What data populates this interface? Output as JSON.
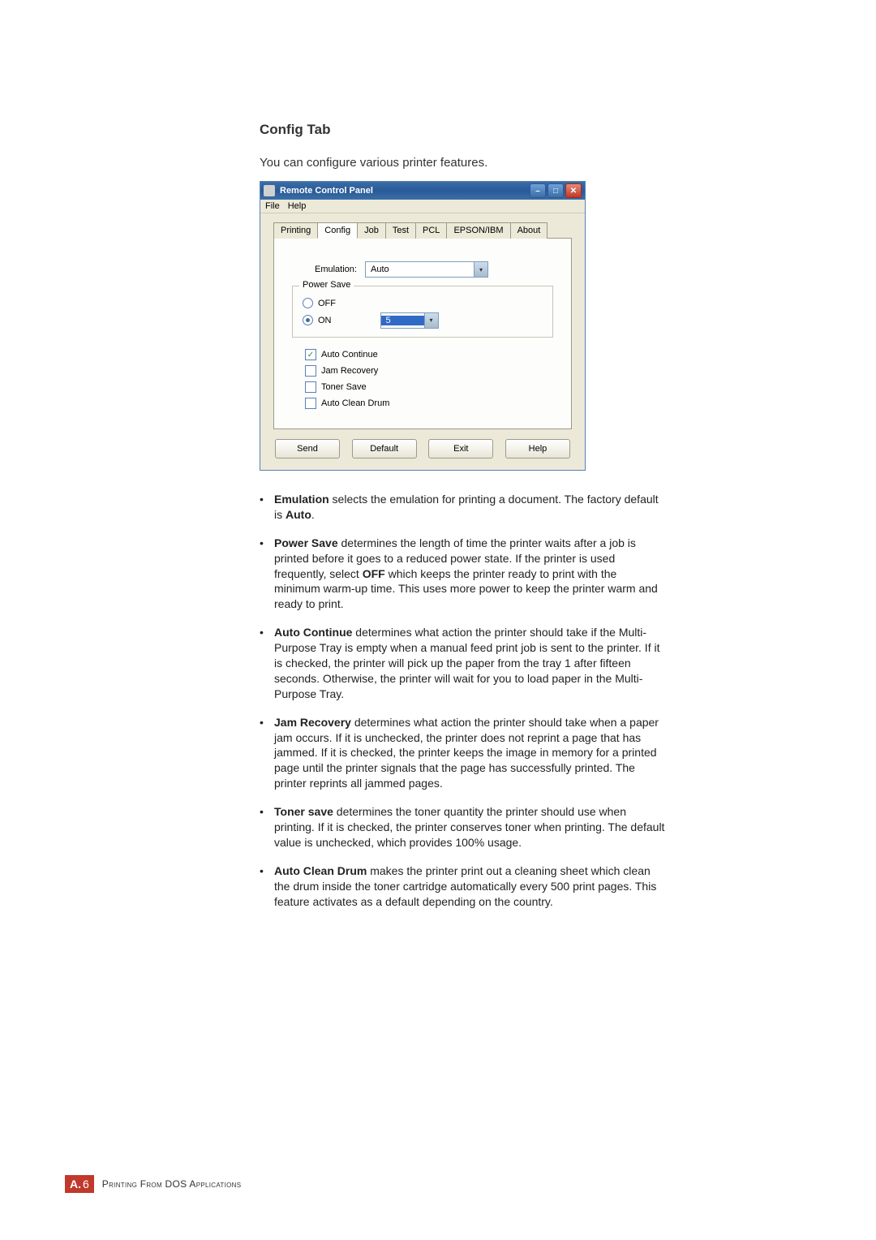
{
  "heading": "Config Tab",
  "intro": "You can configure various printer features.",
  "window": {
    "title": "Remote Control Panel",
    "menu": {
      "file": "File",
      "help": "Help"
    },
    "tabs": [
      "Printing",
      "Config",
      "Job",
      "Test",
      "PCL",
      "EPSON/IBM",
      "About"
    ],
    "active_tab": "Config",
    "emulation": {
      "label": "Emulation:",
      "value": "Auto"
    },
    "powersave": {
      "legend": "Power Save",
      "off": "OFF",
      "on": "ON",
      "value": "5"
    },
    "auto_continue": "Auto Continue",
    "jam_recovery": "Jam Recovery",
    "toner_save": "Toner Save",
    "auto_clean": "Auto Clean Drum",
    "buttons": {
      "send": "Send",
      "default": "Default",
      "exit": "Exit",
      "help": "Help"
    }
  },
  "bullets": {
    "b0_term": "Emulation",
    "b0_rest": " selects the emulation for printing a document. The factory default is ",
    "b0_bold2": "Auto",
    "b0_end": ".",
    "b1_term": "Power Save",
    "b1_rest1": " determines the length of time the printer waits after a job is printed before it goes to a reduced power state. If the printer is used frequently, select ",
    "b1_bold2": "OFF",
    "b1_rest2": " which keeps the printer ready to print with the minimum warm-up time. This uses more power to keep the printer warm and ready to print.",
    "b2_term": "Auto Continue",
    "b2_rest": " determines what action the printer should take if the Multi-Purpose Tray is empty when a manual feed print job is sent to the printer. If it is checked, the printer will pick up the paper from the tray 1 after fifteen seconds. Otherwise, the printer will wait for you to load paper in the Multi-Purpose Tray.",
    "b3_term": "Jam Recovery",
    "b3_rest": " determines what action the printer should take when a paper jam occurs. If it is unchecked, the printer does not reprint a page that has jammed. If it is checked, the printer keeps the image in memory for a printed page until the printer signals that the page has successfully printed. The printer reprints all jammed pages.",
    "b4_term": "Toner save",
    "b4_rest": " determines the toner quantity the printer should use when printing. If it is checked, the printer conserves toner when printing. The default value is unchecked, which provides 100% usage.",
    "b5_term": "Auto Clean Drum",
    "b5_rest": " makes the printer print out a cleaning sheet which clean the drum inside the toner cartridge automatically every 500 print pages. This feature activates as a default depending on the country."
  },
  "footer": {
    "badge_letter": "A.",
    "badge_number": "6",
    "text": "Printing From DOS Applications"
  }
}
